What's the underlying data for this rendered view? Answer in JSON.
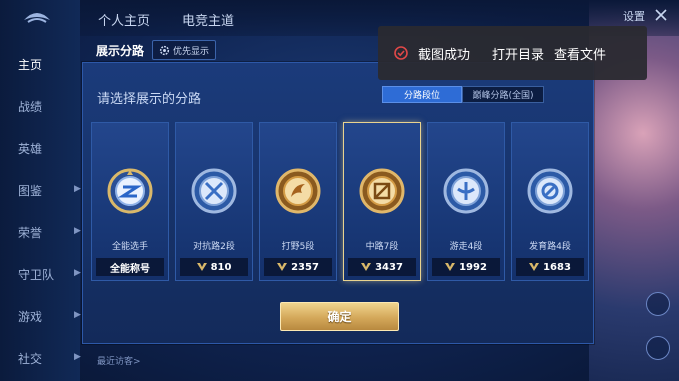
{
  "top_nav": {
    "tabs": [
      "个人主页",
      "电竞主道"
    ],
    "settings_label": "设置"
  },
  "side_nav": {
    "items": [
      "主页",
      "战绩",
      "英雄",
      "图鉴",
      "荣誉",
      "守卫队",
      "游戏",
      "社交"
    ]
  },
  "panel": {
    "title": "展示分路",
    "priority_label": "优先显示",
    "prompt": "请选择展示的分路",
    "tabs": [
      {
        "label": "分路段位",
        "active": true
      },
      {
        "label": "巅峰分路(全国)",
        "active": false
      }
    ],
    "cards": [
      {
        "label": "全能选手",
        "value": "全能称号",
        "selected": false,
        "icon": "allround-icon"
      },
      {
        "label": "对抗路2段",
        "value": "810",
        "selected": false,
        "icon": "clash-lane-icon"
      },
      {
        "label": "打野5段",
        "value": "2357",
        "selected": false,
        "icon": "jungle-icon"
      },
      {
        "label": "中路7段",
        "value": "3437",
        "selected": true,
        "icon": "mid-lane-icon"
      },
      {
        "label": "游走4段",
        "value": "1992",
        "selected": false,
        "icon": "roam-icon"
      },
      {
        "label": "发育路4段",
        "value": "1683",
        "selected": false,
        "icon": "farm-lane-icon"
      }
    ],
    "confirm_label": "确定",
    "recent_label": "最近访客>"
  },
  "toast": {
    "message": "截图成功",
    "open_folder": "打开目录",
    "view_file": "查看文件"
  },
  "colors": {
    "panel_bg": "#163167",
    "accent_gold": "#d4a85a",
    "tab_active": "#2e6cd6",
    "toast_bg": "#2a2a30",
    "check_red": "#e04848"
  }
}
